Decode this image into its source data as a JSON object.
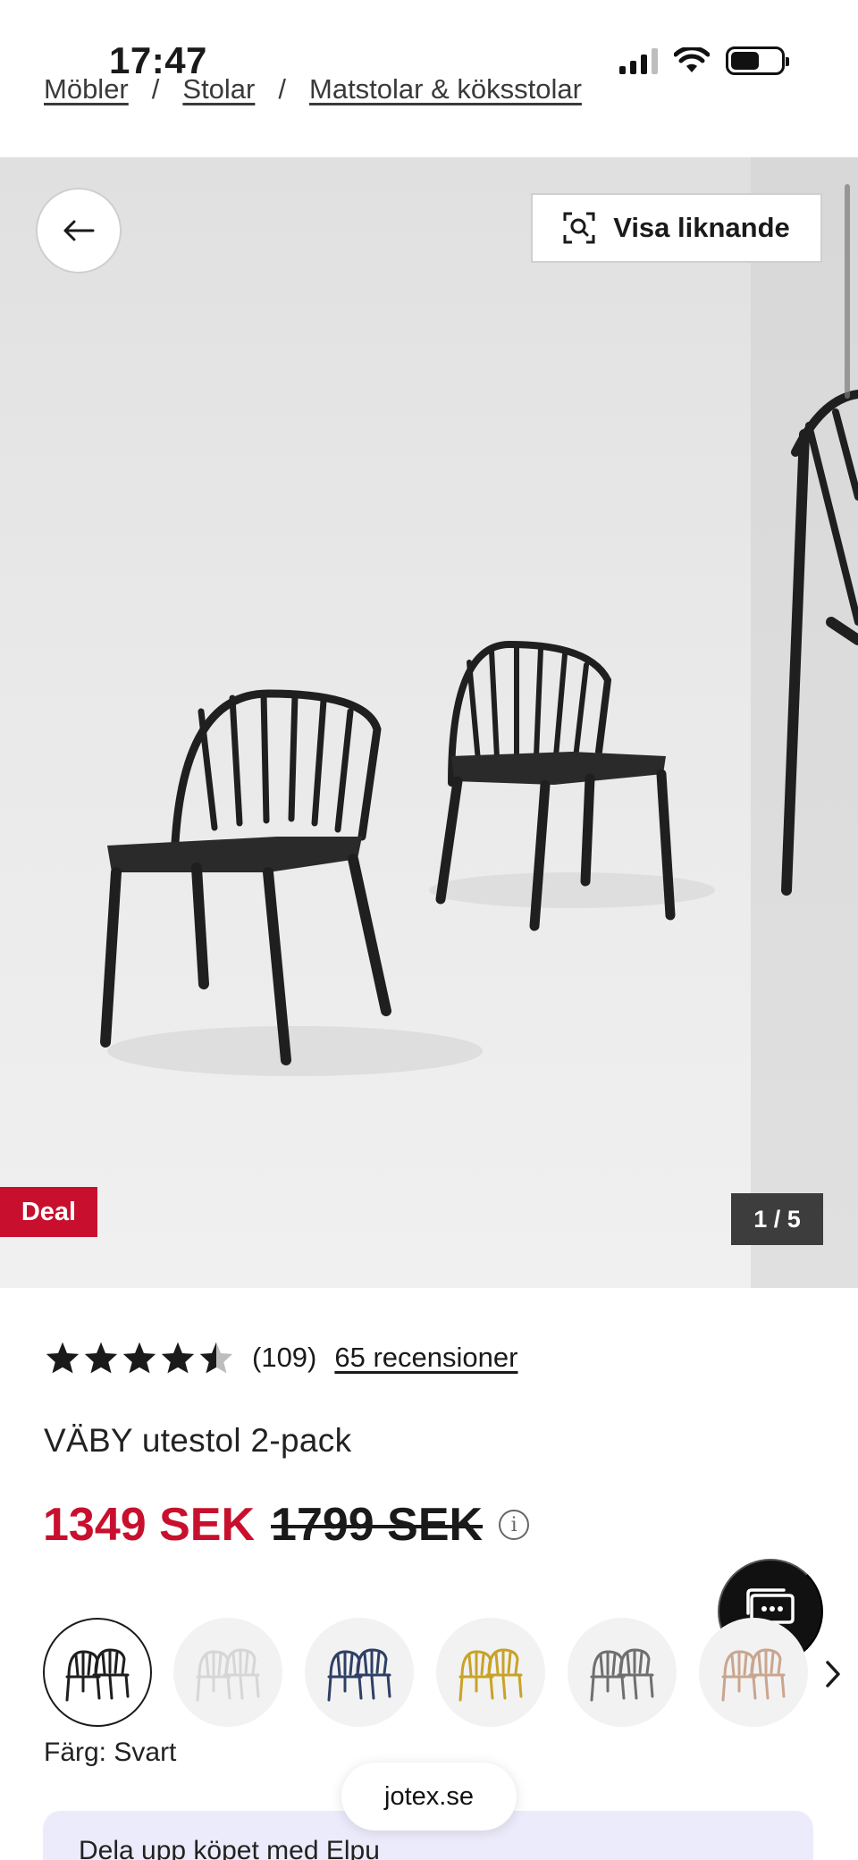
{
  "status_bar": {
    "time": "17:47",
    "icons": [
      "signal-icon",
      "wifi-icon",
      "battery-icon"
    ]
  },
  "breadcrumb": {
    "items": [
      "Möbler",
      "Stolar",
      "Matstolar & köksstolar"
    ],
    "separator": "/"
  },
  "gallery": {
    "back_icon": "arrow-left-icon",
    "similar_button_label": "Visa liknande",
    "similar_button_icon": "visual-search-icon",
    "badge": "Deal",
    "counter": "1 / 5"
  },
  "product": {
    "rating": 4.5,
    "rating_max": 5,
    "rating_count": "(109)",
    "reviews_link": "65 recensioner",
    "title": "VÄBY utestol 2-pack",
    "price_current": "1349 SEK",
    "price_original": "1799 SEK",
    "info_icon": "info-icon",
    "color_prefix": "Färg:",
    "color_value": "Svart"
  },
  "swatches": {
    "items": [
      {
        "name": "Svart",
        "color": "#1e1e1e",
        "selected": true
      },
      {
        "name": "Vit",
        "color": "#f4f4f4",
        "selected": false
      },
      {
        "name": "Blå",
        "color": "#2f3f66",
        "selected": false
      },
      {
        "name": "Gul",
        "color": "#c9a227",
        "selected": false
      },
      {
        "name": "Grå",
        "color": "#6f6f6f",
        "selected": false
      },
      {
        "name": "Beige",
        "color": "#caa58f",
        "selected": false
      }
    ],
    "next_icon": "chevron-right-icon"
  },
  "chat": {
    "icon": "chat-icon"
  },
  "banner": {
    "text": "Dela upp köpet med Elpu"
  },
  "browser": {
    "domain": "jotex.se"
  },
  "colors": {
    "accent_red": "#c8102e",
    "text": "#1a1a1a",
    "banner_bg": "#ecebfb"
  }
}
